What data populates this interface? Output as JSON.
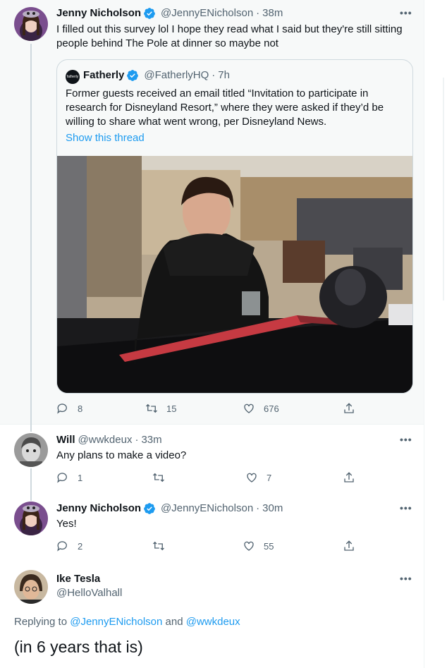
{
  "colors": {
    "accent": "#1d9bf0",
    "secondary_text": "#536471",
    "primary_text": "#0f1419",
    "thread_line": "#cfd9de"
  },
  "tweets": [
    {
      "name": "Jenny Nicholson",
      "handle": "@JennyENicholson",
      "time": "38m",
      "verified": true,
      "text": "I filled out this survey lol I hope they read what I said but they're still sitting people behind The Pole at dinner so maybe not",
      "quote": {
        "name": "Fatherly",
        "avatar_text": "fatherly",
        "handle": "@FatherlyHQ",
        "time": "7h",
        "verified": true,
        "text": "Former guests received an email titled “Invitation to participate in research for Disneyland Resort,” where they were asked if they’d be willing to share what went wrong, per Disneyland News.",
        "show_thread": "Show this thread"
      },
      "replies": "8",
      "retweets": "15",
      "likes": "676"
    },
    {
      "name": "Will",
      "handle": "@wwkdeux",
      "time": "33m",
      "text": "Any plans to make a video?",
      "replies": "1",
      "retweets": "",
      "likes": "7"
    },
    {
      "name": "Jenny Nicholson",
      "handle": "@JennyENicholson",
      "time": "30m",
      "verified": true,
      "text": "Yes!",
      "replies": "2",
      "retweets": "",
      "likes": "55"
    },
    {
      "name": "Ike Tesla",
      "handle": "@HelloValhall",
      "replying_prefix": "Replying to",
      "mention_1": "@JennyENicholson",
      "replying_and": "and",
      "mention_2": "@wwkdeux",
      "text": "(in 6 years that is)"
    }
  ],
  "icons": [
    "more-icon",
    "verified-icon",
    "reply-icon",
    "retweet-icon",
    "like-icon",
    "share-icon"
  ]
}
